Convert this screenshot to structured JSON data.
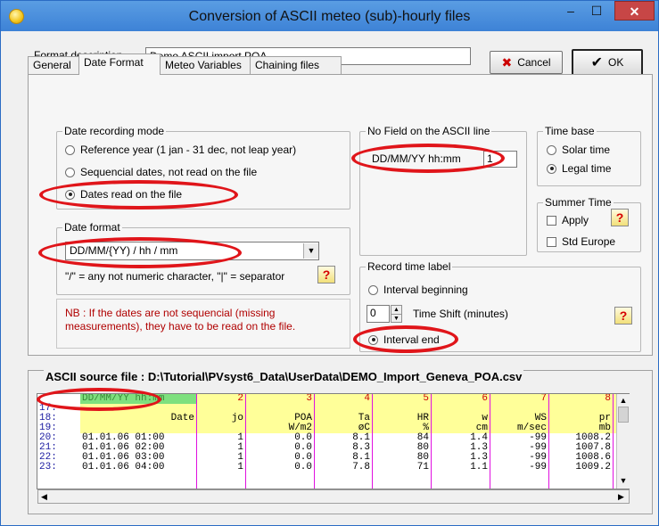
{
  "window": {
    "title": "Conversion of ASCII meteo  (sub)-hourly files",
    "min_symbol": "–",
    "max_symbol": "☐",
    "close_symbol": "✕"
  },
  "format": {
    "label": "Format description",
    "value": "Demo ASCII import POA"
  },
  "buttons": {
    "cancel": "Cancel",
    "ok": "OK",
    "cancel_icon": "✖",
    "ok_icon": "✔"
  },
  "tabs": [
    "General",
    "Date Format",
    "Meteo Variables",
    "Chaining files"
  ],
  "date_recording": {
    "label": "Date recording mode",
    "options": [
      "Reference year (1 jan - 31 dec, not leap year)",
      "Sequencial dates, not read on the file",
      "Dates read on the file"
    ],
    "selected_index": 2
  },
  "date_format": {
    "label": "Date format",
    "value": "DD/MM/{YY)  /  hh / mm",
    "hint": "\"/\" = any not numeric character,  \"|\" = separator"
  },
  "nb_text": "NB : If the dates are not sequencial (missing measurements), they have to be read on the file.",
  "no_field": {
    "label": "No Field on the ASCII line",
    "field_label": "DD/MM/YY hh:mm",
    "field_value": "1"
  },
  "time_base": {
    "label": "Time base",
    "options": [
      "Solar time",
      "Legal time"
    ],
    "selected_index": 1
  },
  "summer_time": {
    "label": "Summer Time",
    "apply_label": "Apply",
    "std_europe_label": "Std Europe",
    "apply_checked": false,
    "std_checked": false
  },
  "record_time": {
    "label": "Record time label",
    "interval_beginning": "Interval beginning",
    "interval_end": "Interval end",
    "shift_value": "0",
    "shift_label": "Time Shift (minutes)",
    "selected": "end"
  },
  "help_symbol": "?",
  "ascii_source": {
    "title": "ASCII source file : D:\\Tutorial\\PVsyst6_Data\\UserData\\DEMO_Import_Geneva_POA.csv",
    "header_cells": [
      "DD/MM/YY hh:mm",
      "2",
      "3",
      "4",
      "5",
      "6",
      "7",
      "8"
    ],
    "rows": [
      {
        "num": "17:",
        "cells": [
          "",
          "",
          "",
          "",
          "",
          "",
          "",
          ""
        ]
      },
      {
        "num": "18:",
        "cells": [
          "Date",
          "jo",
          "POA",
          "Ta",
          "HR",
          "w",
          "WS",
          "pr"
        ]
      },
      {
        "num": "19:",
        "cells": [
          "",
          "",
          "W/m2",
          "øC",
          "%",
          "cm",
          "m/sec",
          "mb"
        ]
      },
      {
        "num": "20:",
        "cells": [
          "01.01.06 01:00",
          "1",
          "0.0",
          "8.1",
          "84",
          "1.4",
          "-99",
          "1008.2"
        ]
      },
      {
        "num": "21:",
        "cells": [
          "01.01.06 02:00",
          "1",
          "0.0",
          "8.3",
          "80",
          "1.3",
          "-99",
          "1007.8"
        ]
      },
      {
        "num": "22:",
        "cells": [
          "01.01.06 03:00",
          "1",
          "0.0",
          "8.1",
          "80",
          "1.3",
          "-99",
          "1008.6"
        ]
      },
      {
        "num": "23:",
        "cells": [
          "01.01.06 04:00",
          "1",
          "0.0",
          "7.8",
          "71",
          "1.1",
          "-99",
          "1009.2"
        ]
      }
    ]
  }
}
